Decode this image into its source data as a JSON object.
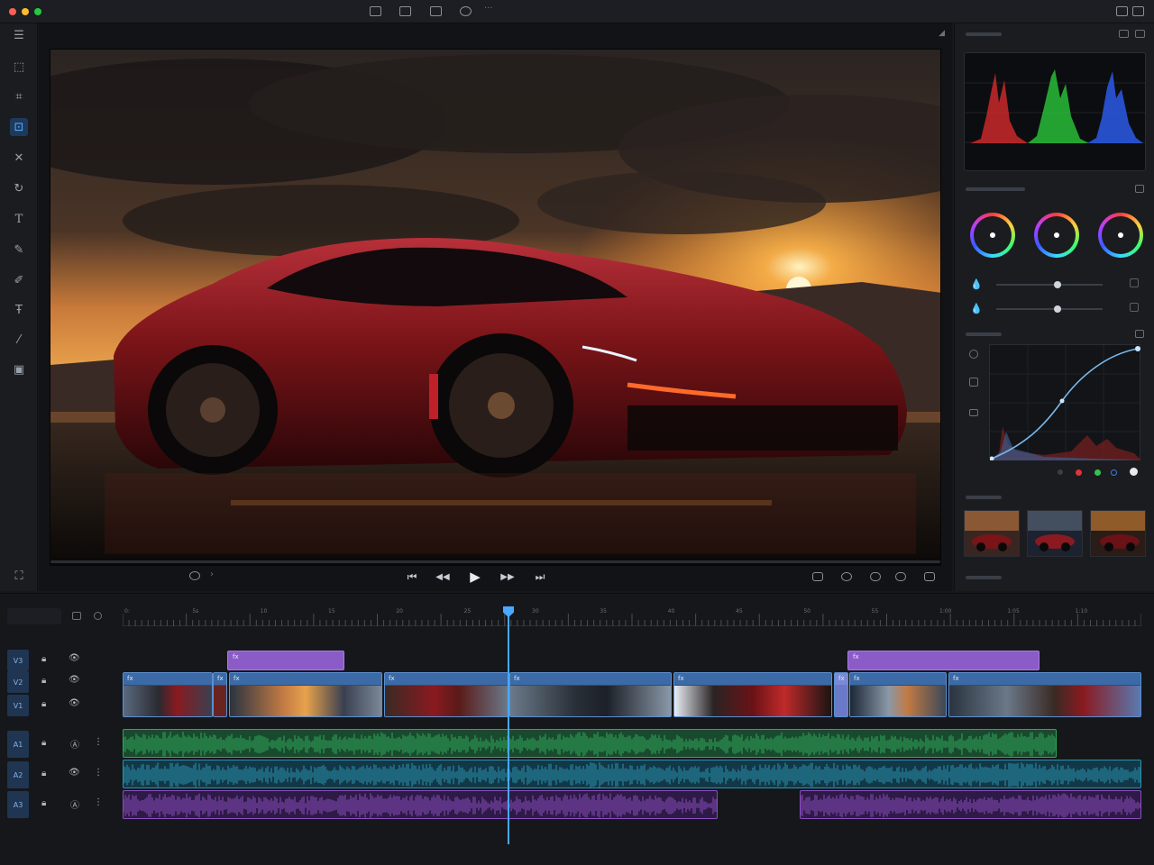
{
  "window": {
    "title_icons": [
      "single-view-icon",
      "grid-view-icon",
      "frame-view-icon",
      "circle-view-icon"
    ],
    "right_icons": [
      "panel-left-icon",
      "panel-right-icon"
    ]
  },
  "left_toolbar": {
    "tools": [
      {
        "name": "menu-lines-icon",
        "glyph": "☰"
      },
      {
        "name": "select-icon",
        "glyph": "⬚"
      },
      {
        "name": "crop-icon",
        "glyph": "⌗"
      },
      {
        "name": "transform-icon",
        "glyph": "⊡",
        "active": true
      },
      {
        "name": "expand-icon",
        "glyph": "✕"
      },
      {
        "name": "rotate-icon",
        "glyph": "↻"
      },
      {
        "name": "text-icon",
        "glyph": "T"
      },
      {
        "name": "pen-icon",
        "glyph": "✎"
      },
      {
        "name": "brush-icon",
        "glyph": "✐"
      },
      {
        "name": "text-path-icon",
        "glyph": "Ŧ"
      },
      {
        "name": "eyedropper-icon",
        "glyph": "⁄"
      },
      {
        "name": "color-box-icon",
        "glyph": "▣"
      },
      {
        "name": "fullscreen-icon",
        "glyph": "⛶"
      }
    ]
  },
  "viewer": {
    "transport": [
      "⏮",
      "◀◀",
      "▶",
      "▶▶",
      "⏭"
    ],
    "loop_label": "›"
  },
  "right_panel": {
    "accent": "#4aa8ff"
  },
  "timeline": {
    "ruler_labels": [
      "0:",
      "5s",
      "10",
      "15",
      "20",
      "25",
      "30",
      "35",
      "40",
      "45",
      "50",
      "55",
      "1:00",
      "1:05",
      "1:10",
      "1:15"
    ],
    "tracks": {
      "video": [
        {
          "label": "V3"
        },
        {
          "label": "V2"
        },
        {
          "label": "V1"
        }
      ],
      "audio": [
        {
          "label": "A1"
        },
        {
          "label": "A2"
        },
        {
          "label": "A3"
        }
      ]
    },
    "title_clips": [
      {
        "label": "fx"
      },
      {
        "label": "fx"
      }
    ],
    "video_clips": [
      {
        "label": "fx"
      },
      {
        "label": "fx"
      },
      {
        "label": "fx"
      },
      {
        "label": "fx"
      },
      {
        "label": "fx"
      },
      {
        "label": "fx"
      },
      {
        "label": "fx"
      },
      {
        "label": "fx"
      },
      {
        "label": "fx"
      }
    ],
    "audio_colors": {
      "A1": "#2fa85a",
      "A2": "#2a93b0",
      "A3": "#8a4ec0"
    }
  }
}
